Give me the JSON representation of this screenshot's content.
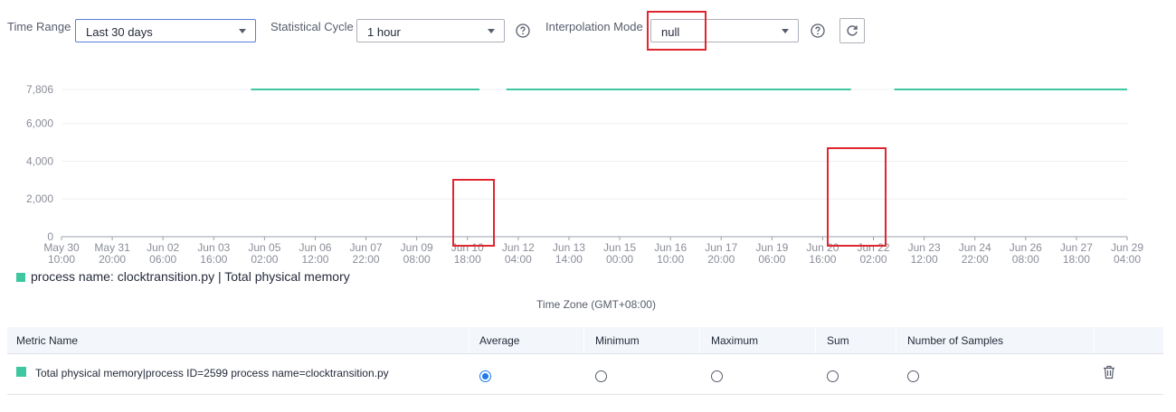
{
  "filters": {
    "time_range": {
      "label": "Time Range",
      "value": "Last 30 days"
    },
    "statistical_cycle": {
      "label": "Statistical Cycle",
      "value": "1 hour"
    },
    "interpolation_mode": {
      "label": "Interpolation Mode",
      "value": "null"
    }
  },
  "chart_data": {
    "type": "line",
    "ylim": [
      0,
      7806
    ],
    "yticks": [
      0,
      2000,
      4000,
      6000,
      7806
    ],
    "ytick_labels": [
      "0",
      "2,000",
      "4,000",
      "6,000",
      "7,806"
    ],
    "xtick_labels": [
      [
        "May 30",
        "10:00"
      ],
      [
        "May 31",
        "20:00"
      ],
      [
        "Jun 02",
        "06:00"
      ],
      [
        "Jun 03",
        "16:00"
      ],
      [
        "Jun 05",
        "02:00"
      ],
      [
        "Jun 06",
        "12:00"
      ],
      [
        "Jun 07",
        "22:00"
      ],
      [
        "Jun 09",
        "08:00"
      ],
      [
        "Jun 10",
        "18:00"
      ],
      [
        "Jun 12",
        "04:00"
      ],
      [
        "Jun 13",
        "14:00"
      ],
      [
        "Jun 15",
        "00:00"
      ],
      [
        "Jun 16",
        "10:00"
      ],
      [
        "Jun 17",
        "20:00"
      ],
      [
        "Jun 19",
        "06:00"
      ],
      [
        "Jun 20",
        "16:00"
      ],
      [
        "Jun 22",
        "02:00"
      ],
      [
        "Jun 23",
        "12:00"
      ],
      [
        "Jun 24",
        "22:00"
      ],
      [
        "Jun 26",
        "08:00"
      ],
      [
        "Jun 27",
        "18:00"
      ],
      [
        "Jun 29",
        "04:00"
      ]
    ],
    "series": [
      {
        "name": "process name: clocktransition.py | Total physical memory",
        "color": "#3ec7a0",
        "segments": [
          {
            "from": "Jun 04 17:00",
            "to": "Jun 11 02:00",
            "value": 7806
          },
          {
            "from": "Jun 11 20:00",
            "to": "Jun 21 11:00",
            "value": 7806
          },
          {
            "from": "Jun 22 16:00",
            "to": "Jun 29 04:00",
            "value": 7806
          }
        ]
      }
    ],
    "legend": "process name: clocktransition.py | Total physical memory",
    "grid": true
  },
  "time_zone": "Time Zone (GMT+08:00)",
  "table": {
    "headers": [
      "Metric Name",
      "Average",
      "Minimum",
      "Maximum",
      "Sum",
      "Number of Samples"
    ],
    "rows": [
      {
        "metric": "Total physical memory|process ID=2599 process name=clocktransition.py",
        "color": "#3ec7a0",
        "selected": "Average"
      }
    ]
  }
}
